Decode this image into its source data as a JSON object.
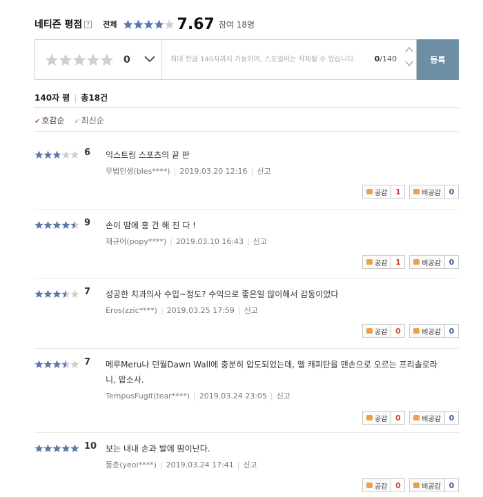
{
  "header": {
    "title": "네티즌 평점",
    "help": "?",
    "all_label": "전체",
    "rating": "7.67",
    "rating_stars": 4,
    "participants": "참여 18명"
  },
  "form": {
    "rating_value": "0",
    "placeholder": "최대 한글 140자까지 가능하며, 스포일러는 삭제될 수 있습니다.",
    "char_count": "0",
    "char_max": "/140",
    "submit_label": "등록"
  },
  "summary": {
    "label": "140자 평",
    "total": "총18건"
  },
  "sort": {
    "active": "호감순",
    "inactive": "최신순"
  },
  "vote_labels": {
    "like": "공감",
    "dislike": "비공감",
    "report": "신고"
  },
  "colors": {
    "star_on": "#5a79a8",
    "star_off": "#cfcfcf",
    "submit_bg": "#6c8fa6",
    "like_count": "#d0402b",
    "dislike_count": "#3b5998"
  },
  "reviews": [
    {
      "score": "6",
      "stars": 3,
      "text": "익스트림 스포츠의 끝 판",
      "author": "무법인생(bles****)",
      "date": "2019.03.20 12:16",
      "likes": "1",
      "dislikes": "0"
    },
    {
      "score": "9",
      "stars": 4.5,
      "text": "손이 땀에 흥 건 해 진 다 !",
      "author": "재규어(popy****)",
      "date": "2019.03.10 16:43",
      "likes": "1",
      "dislikes": "0"
    },
    {
      "score": "7",
      "stars": 3.5,
      "text": "성공한 치과의사 수입~정도? 수익으로 좋은일 많이해서 감동이었다",
      "author": "Eros(zzic****)",
      "date": "2019.03.25 17:59",
      "likes": "0",
      "dislikes": "0"
    },
    {
      "score": "7",
      "stars": 3.5,
      "text": "메루Meru나 던월Dawn Wall에 충분히 압도되었는데, 엘 캐피탄을 맨손으로 오르는 프리솔로라니, 맙소사.",
      "author": "TempusFugit(tear****)",
      "date": "2019.03.24 23:05",
      "likes": "0",
      "dislikes": "0"
    },
    {
      "score": "10",
      "stars": 5,
      "text": "보는 내내 손과 발에 땀이난다.",
      "author": "동춘(yeoi****)",
      "date": "2019.03.24 17:41",
      "likes": "0",
      "dislikes": "0"
    }
  ]
}
